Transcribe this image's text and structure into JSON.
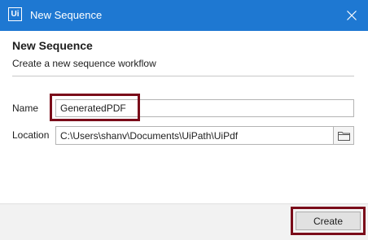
{
  "window": {
    "logo_text": "Ui",
    "title": "New Sequence",
    "accent_color": "#1e78d2"
  },
  "header": {
    "title": "New Sequence",
    "subtitle": "Create a new sequence workflow"
  },
  "form": {
    "name_label": "Name",
    "name_value": "GeneratedPDF",
    "location_label": "Location",
    "location_value": "C:\\Users\\shanv\\Documents\\UiPath\\UiPdf"
  },
  "icons": {
    "close": "close-icon",
    "folder": "folder-icon"
  },
  "footer": {
    "create_label": "Create"
  },
  "highlight_color": "#7a0c1a"
}
